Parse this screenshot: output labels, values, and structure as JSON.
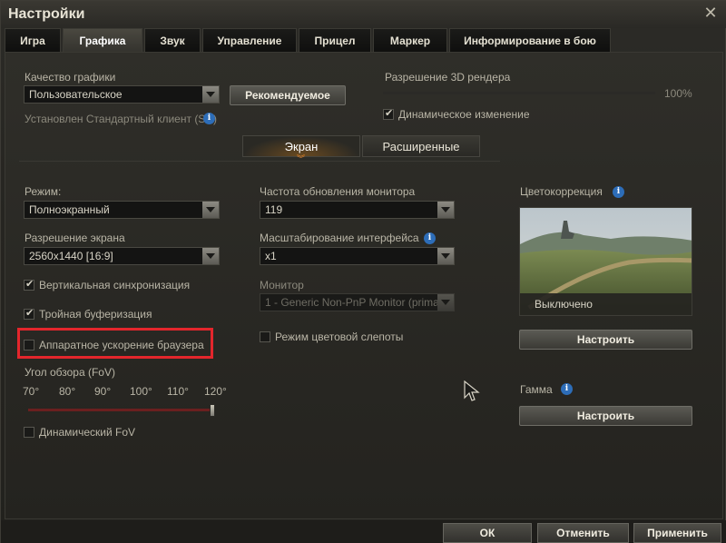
{
  "window": {
    "title": "Настройки"
  },
  "tabs": [
    {
      "label": "Игра",
      "active": false
    },
    {
      "label": "Графика",
      "active": true
    },
    {
      "label": "Звук",
      "active": false
    },
    {
      "label": "Управление",
      "active": false
    },
    {
      "label": "Прицел",
      "active": false
    },
    {
      "label": "Маркер",
      "active": false
    },
    {
      "label": "Информирование в бою",
      "active": false
    }
  ],
  "quality": {
    "label": "Качество графики",
    "value": "Пользовательское",
    "recommended_button": "Рекомендуемое",
    "client_note": "Установлен Стандартный клиент (SD)"
  },
  "render": {
    "label": "Разрешение 3D рендера",
    "value_text": "100%",
    "fraction": 1.0,
    "dynamic_label": "Динамическое изменение",
    "dynamic_checked": true
  },
  "subtabs": {
    "screen": "Экран",
    "advanced": "Расширенные"
  },
  "mode": {
    "label": "Режим:",
    "value": "Полноэкранный"
  },
  "resolution": {
    "label": "Разрешение экрана",
    "value": "2560x1440 [16:9]"
  },
  "vsync": {
    "label": "Вертикальная синхронизация",
    "checked": true
  },
  "triple": {
    "label": "Тройная буферизация",
    "checked": true
  },
  "hwaccel": {
    "label": "Аппаратное ускорение браузера",
    "checked": false
  },
  "fov": {
    "label": "Угол обзора (FoV)",
    "ticks": [
      "70°",
      "80°",
      "90°",
      "100°",
      "110°",
      "120°"
    ],
    "value": 120,
    "dynamic_label": "Динамический FoV",
    "dynamic_checked": false
  },
  "refresh": {
    "label": "Частота обновления монитора",
    "value": "119"
  },
  "scaling": {
    "label": "Масштабирование интерфейса",
    "value": "x1"
  },
  "monitor": {
    "label": "Монитор",
    "value": "1 - Generic Non-PnP Monitor (prima"
  },
  "colorblind": {
    "label": "Режим цветовой слепоты",
    "checked": false
  },
  "color_correction": {
    "label": "Цветокоррекция",
    "preview_text": "Выключено",
    "button": "Настроить"
  },
  "gamma": {
    "label": "Гамма",
    "button": "Настроить"
  },
  "footer": {
    "ok": "ОК",
    "cancel": "Отменить",
    "apply": "Применить"
  },
  "colors": {
    "highlight": "#e3262c",
    "accent": "#f08a2a",
    "info": "#2d6db8"
  }
}
